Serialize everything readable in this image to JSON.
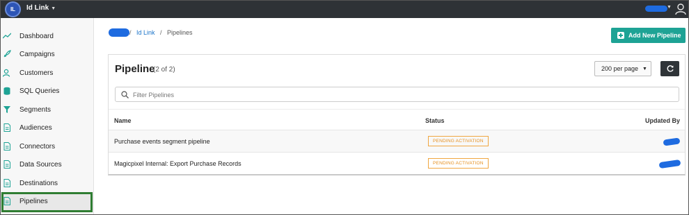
{
  "header": {
    "logo_text": "IL",
    "app_name": "Id Link",
    "colors": {
      "bar": "#2e3236",
      "accent": "#1ea395"
    }
  },
  "sidebar": {
    "items": [
      {
        "label": "Dashboard",
        "icon": "line-chart-icon"
      },
      {
        "label": "Campaigns",
        "icon": "rocket-icon"
      },
      {
        "label": "Customers",
        "icon": "user-search-icon"
      },
      {
        "label": "SQL Queries",
        "icon": "database-icon"
      },
      {
        "label": "Segments",
        "icon": "filter-icon"
      },
      {
        "label": "Audiences",
        "icon": "document-icon"
      },
      {
        "label": "Connectors",
        "icon": "document-icon"
      },
      {
        "label": "Data Sources",
        "icon": "document-icon"
      },
      {
        "label": "Destinations",
        "icon": "document-icon"
      },
      {
        "label": "Pipelines",
        "icon": "document-icon",
        "active": true
      }
    ]
  },
  "breadcrumb": {
    "separator": "/",
    "link": "Id Link",
    "current": "Pipelines"
  },
  "actions": {
    "add_label": "Add New Pipeline"
  },
  "card": {
    "title": "Pipeline",
    "count": "(2 of 2)",
    "per_page": "200 per page",
    "filter_placeholder": "Filter Pipelines"
  },
  "table": {
    "columns": {
      "name": "Name",
      "status": "Status",
      "updated_by": "Updated By"
    },
    "rows": [
      {
        "name": "Purchase events segment pipeline",
        "status": "PENDING ACTIVATION"
      },
      {
        "name": "Magicpixel Internal: Export Purchase Records",
        "status": "PENDING ACTIVATION"
      }
    ]
  }
}
